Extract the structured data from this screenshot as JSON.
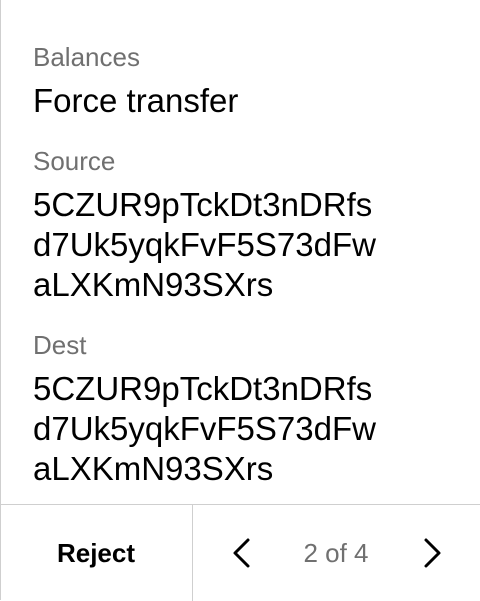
{
  "header": {
    "section_label": "Balances",
    "action_title": "Force transfer"
  },
  "fields": {
    "source": {
      "label": "Source",
      "address_lines": [
        "5CZUR9pTckDt3nDRfs",
        "d7Uk5yqkFvF5S73dFw",
        "aLXKmN93SXrs"
      ]
    },
    "dest": {
      "label": "Dest",
      "address_lines": [
        "5CZUR9pTckDt3nDRfs",
        "d7Uk5yqkFvF5S73dFw",
        "aLXKmN93SXrs"
      ]
    }
  },
  "footer": {
    "reject_label": "Reject",
    "pager_text": "2 of 4",
    "prev_icon": "chevron-left-icon",
    "next_icon": "chevron-right-icon"
  },
  "colors": {
    "label_gray": "#707070",
    "divider": "#cfcfcf",
    "text": "#000000"
  }
}
